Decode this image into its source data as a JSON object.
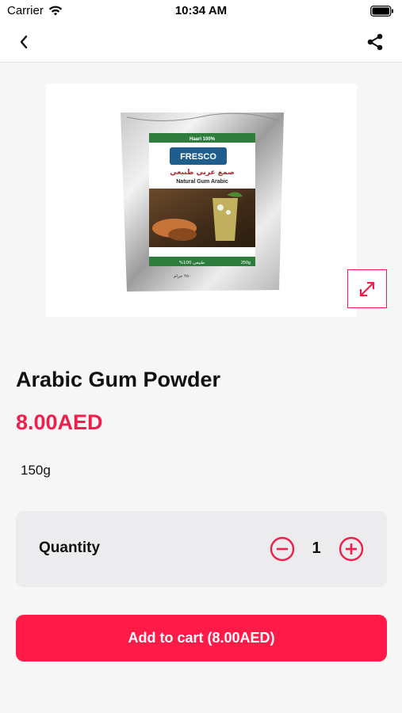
{
  "status_bar": {
    "carrier": "Carrier",
    "time": "10:34 AM",
    "icons": [
      "wifi-icon",
      "battery-icon"
    ]
  },
  "nav": {
    "back_icon": "chevron-left-icon",
    "share_icon": "share-icon"
  },
  "product": {
    "image": {
      "package_header": "Haari 100%",
      "brand": "FRESCO",
      "arabic_name": "صمغ عربي طبيعي",
      "english_name": "Natural Gum Arabic",
      "footer_left": "%100 طبيعي",
      "footer_right": "250g",
      "footer_weight": "٢٥٠ جرام"
    },
    "expand_icon": "expand-arrows-icon",
    "name": "Arabic Gum Powder",
    "price": "8.00AED",
    "size": "150g"
  },
  "quantity": {
    "label": "Quantity",
    "value": "1",
    "minus_icon": "minus-circle-icon",
    "plus_icon": "plus-circle-icon"
  },
  "cart": {
    "button_label": "Add to cart (8.00AED)"
  },
  "colors": {
    "accent": "#ef1f4b",
    "button": "#ff1a47",
    "background": "#f6f6f7",
    "qty_card": "#ececee"
  }
}
